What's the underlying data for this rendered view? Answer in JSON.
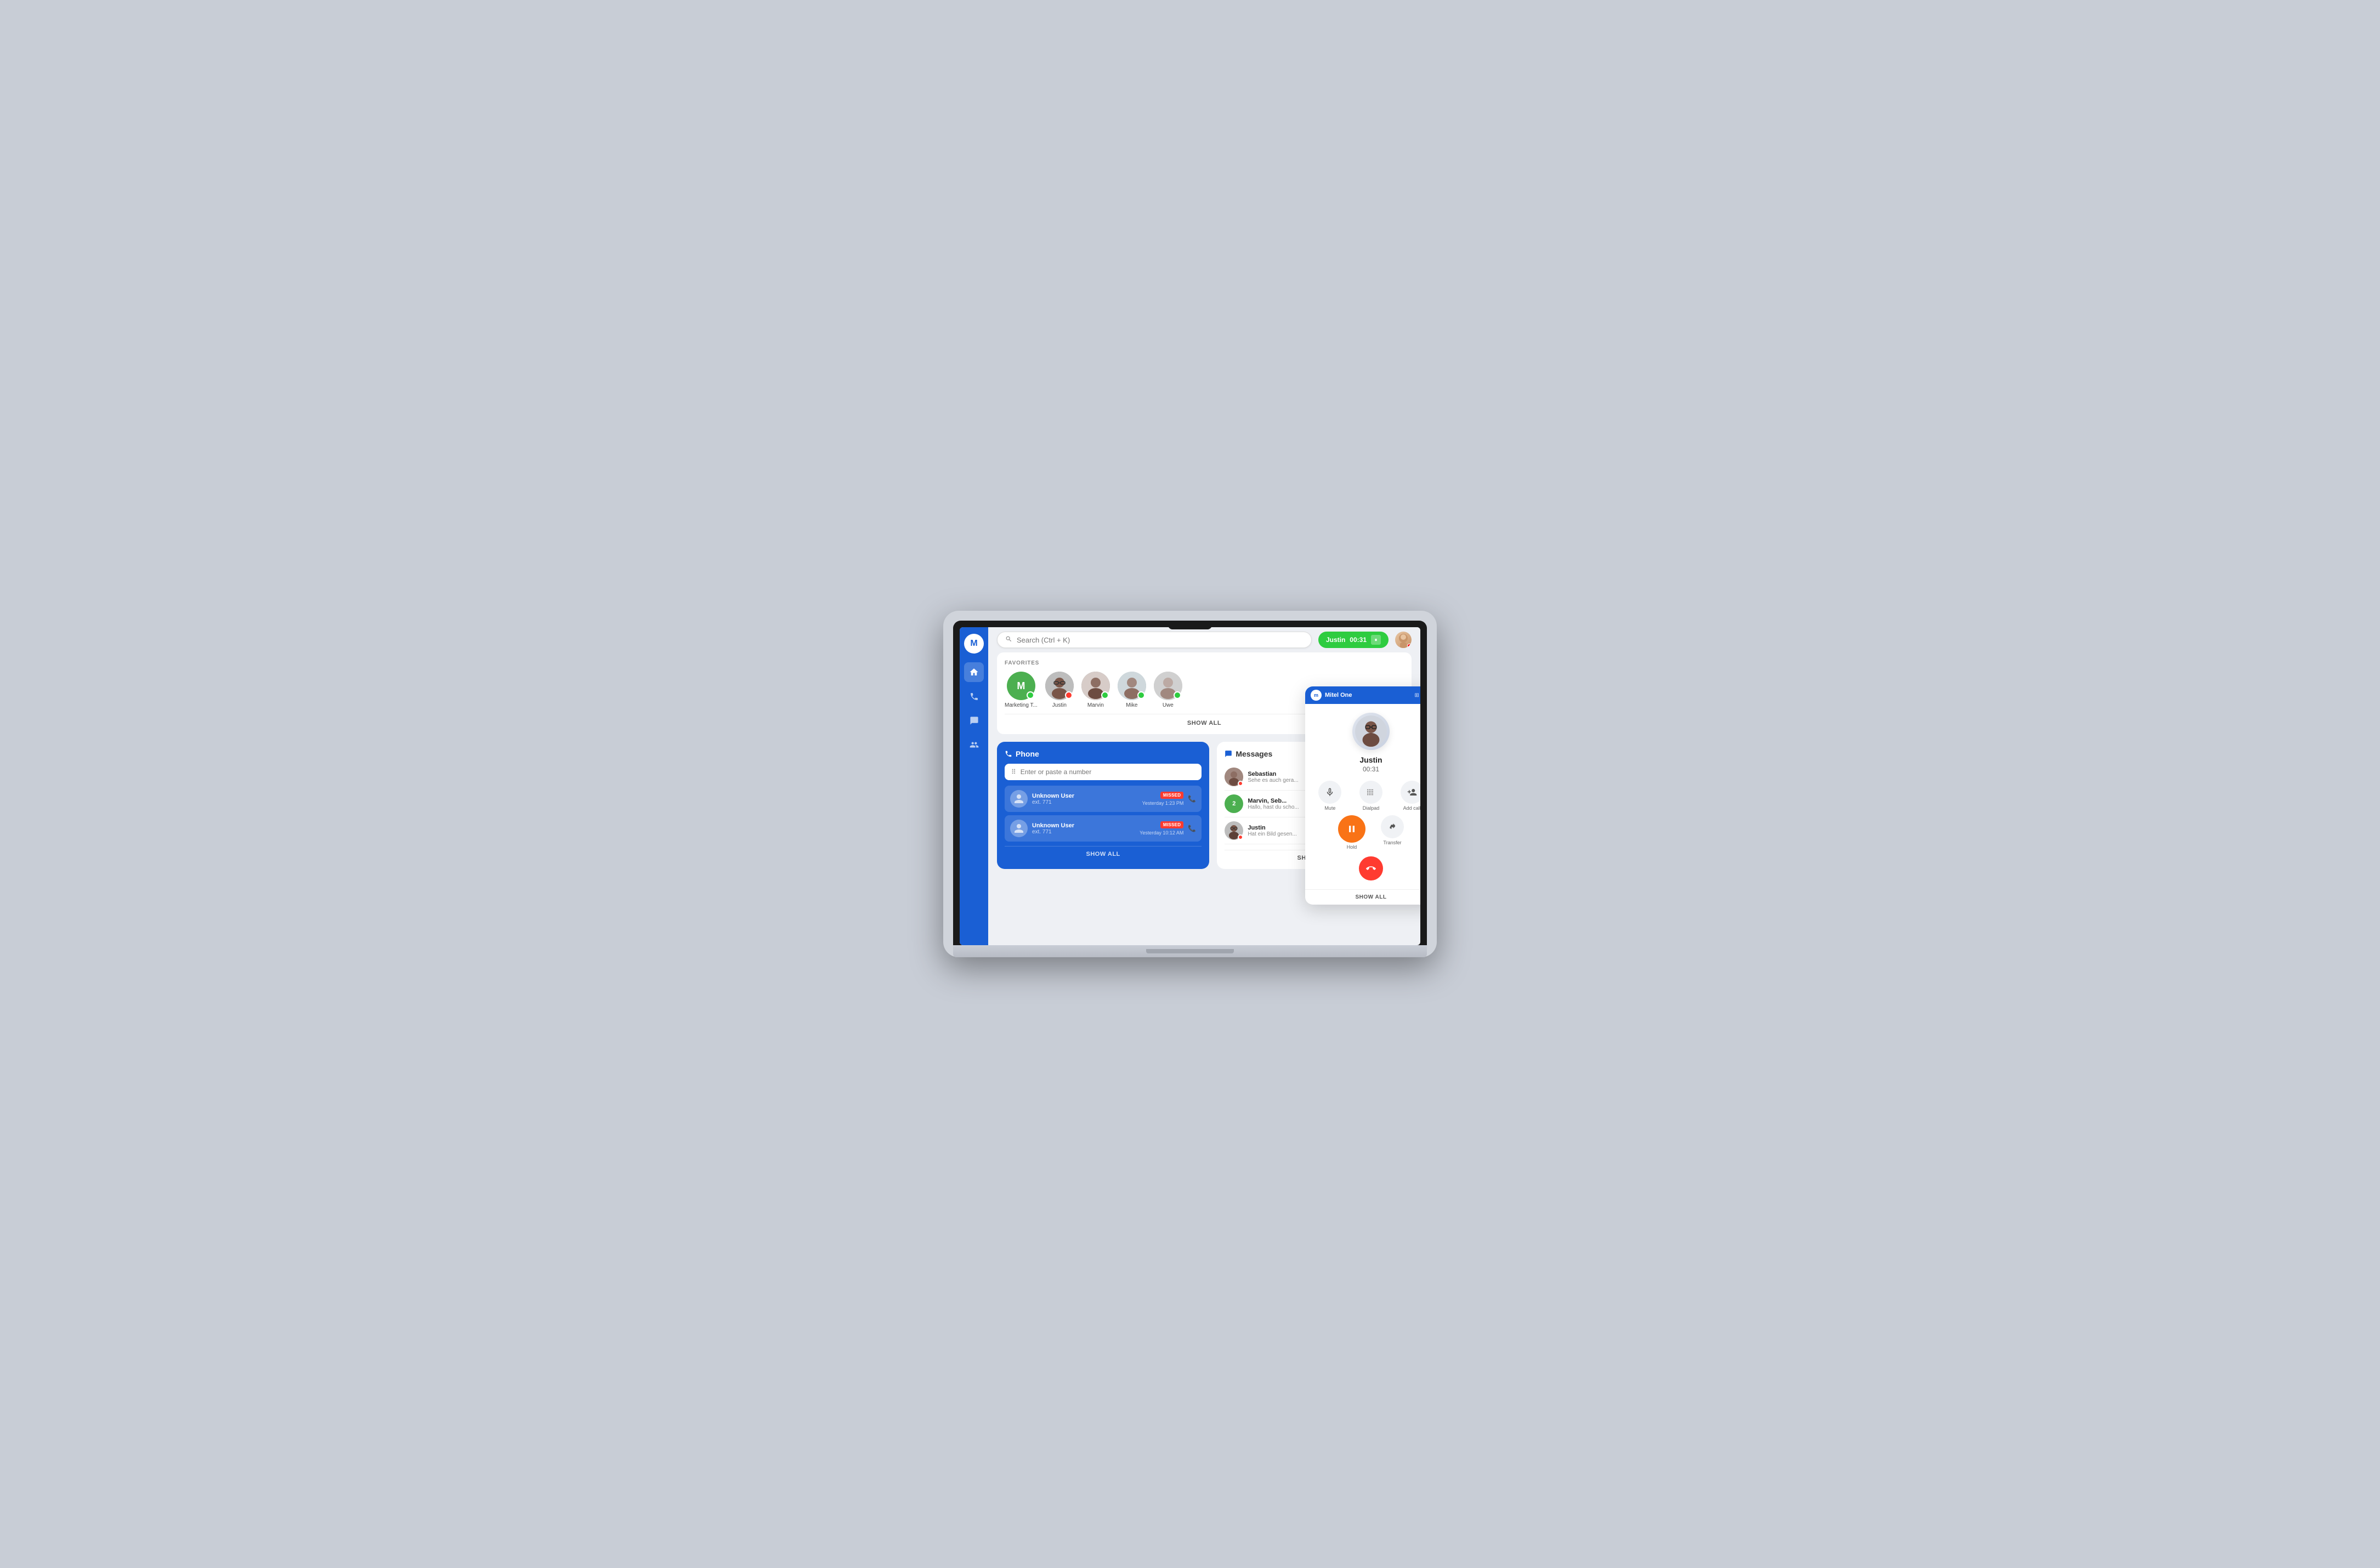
{
  "app": {
    "title": "Mitel One"
  },
  "header": {
    "search_placeholder": "Search (Ctrl + K)",
    "call_label": "Justin",
    "call_duration": "00:31",
    "pause_icon": "⏸"
  },
  "sidebar": {
    "logo": "M",
    "items": [
      {
        "label": "Home",
        "icon": "⌂",
        "active": true
      },
      {
        "label": "Phone",
        "icon": "📞",
        "active": false
      },
      {
        "label": "Messages",
        "icon": "💬",
        "active": false
      },
      {
        "label": "Contacts",
        "icon": "👥",
        "active": false
      }
    ]
  },
  "favorites": {
    "section_label": "FAVORITES",
    "show_all": "SHOW ALL",
    "items": [
      {
        "name": "Marketing T...",
        "initials": "M",
        "color": "#4CAF50",
        "status": "online",
        "type": "initials"
      },
      {
        "name": "Justin",
        "status": "busy",
        "type": "photo"
      },
      {
        "name": "Marvin",
        "status": "online",
        "type": "photo"
      },
      {
        "name": "Mike",
        "status": "online",
        "type": "photo"
      },
      {
        "name": "Uwe",
        "status": "online",
        "type": "photo"
      }
    ]
  },
  "phone": {
    "title": "Phone",
    "input_placeholder": "Enter or paste a number",
    "show_all": "SHOW ALL",
    "calls": [
      {
        "name": "Unknown User",
        "ext": "ext. 771",
        "badge": "MISSED",
        "time": "Yesterday 1:23 PM"
      },
      {
        "name": "Unknown User",
        "ext": "ext. 771",
        "badge": "MISSED",
        "time": "Yesterday 10:12 AM"
      }
    ]
  },
  "messages": {
    "title": "Messages",
    "show_all": "SHOW ALL",
    "items": [
      {
        "sender": "Sebastian",
        "preview": "Sehe es auch gera...",
        "unread": true
      },
      {
        "sender": "Marvin, Seb...",
        "preview": "Hallo, hast du scho...",
        "unread": false,
        "group": true,
        "count": "2"
      },
      {
        "sender": "Justin",
        "preview": "Hat ein Bild gesen...",
        "unread": true
      }
    ]
  },
  "call_widget": {
    "header_title": "Mitel One",
    "logo": "m",
    "contact_name": "Justin",
    "duration": "00:31",
    "controls": [
      {
        "label": "Mute",
        "icon": "🎙"
      },
      {
        "label": "Dialpad",
        "icon": "⠿"
      },
      {
        "label": "Add call",
        "icon": "👤+"
      }
    ],
    "hold_label": "Hold",
    "transfer_label": "Transfer",
    "show_all": "SHOW ALL"
  }
}
